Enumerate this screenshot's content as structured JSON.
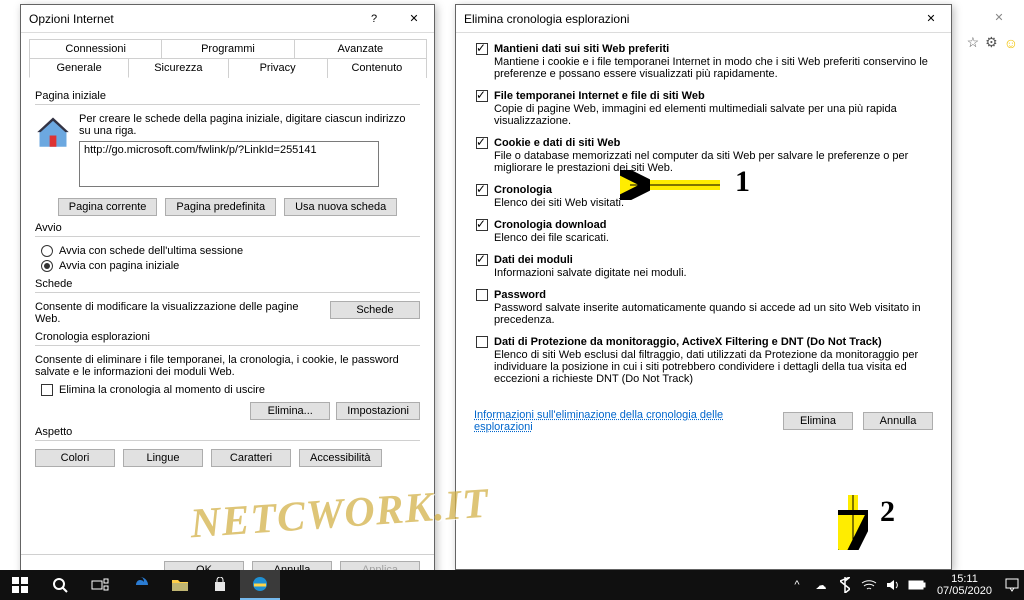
{
  "io": {
    "title": "Opzioni Internet",
    "tabs_row1": [
      "Connessioni",
      "Programmi",
      "Avanzate"
    ],
    "tabs_row2": [
      "Generale",
      "Sicurezza",
      "Privacy",
      "Contenuto"
    ],
    "active_tab": "Generale",
    "home": {
      "group": "Pagina iniziale",
      "hint": "Per creare le schede della pagina iniziale, digitare ciascun indirizzo su una riga.",
      "url": "http://go.microsoft.com/fwlink/p/?LinkId=255141",
      "btn_current": "Pagina corrente",
      "btn_default": "Pagina predefinita",
      "btn_newtab": "Usa nuova scheda"
    },
    "startup": {
      "group": "Avvio",
      "opt_last": "Avvia con schede dell'ultima sessione",
      "opt_home": "Avvia con pagina iniziale",
      "selected": "home"
    },
    "tabs_section": {
      "group": "Schede",
      "text": "Consente di modificare la visualizzazione delle pagine Web.",
      "btn": "Schede"
    },
    "history": {
      "group": "Cronologia esplorazioni",
      "text": "Consente di eliminare i file temporanei, la cronologia, i cookie, le password salvate e le informazioni dei moduli Web.",
      "chk": "Elimina la cronologia al momento di uscire",
      "btn_del": "Elimina...",
      "btn_set": "Impostazioni"
    },
    "appearance": {
      "group": "Aspetto",
      "btn_colors": "Colori",
      "btn_lang": "Lingue",
      "btn_fonts": "Caratteri",
      "btn_access": "Accessibilità"
    },
    "footer": {
      "ok": "OK",
      "cancel": "Annulla",
      "apply": "Applica"
    }
  },
  "del": {
    "title": "Elimina cronologia esplorazioni",
    "items": [
      {
        "checked": true,
        "hd": "Mantieni dati sui siti Web preferiti",
        "sub": "Mantiene i cookie e i file temporanei Internet in modo che i siti Web preferiti conservino le preferenze e possano essere visualizzati più rapidamente."
      },
      {
        "checked": true,
        "hd": "File temporanei Internet e file di siti Web",
        "sub": "Copie di pagine Web, immagini ed elementi multimediali salvate per una più rapida visualizzazione."
      },
      {
        "checked": true,
        "hd": "Cookie e dati di siti Web",
        "sub": "File o database memorizzati nel computer da siti Web per salvare le preferenze o per migliorare le prestazioni dei siti Web."
      },
      {
        "checked": true,
        "hd": "Cronologia",
        "sub": "Elenco dei siti Web visitati."
      },
      {
        "checked": true,
        "hd": "Cronologia download",
        "sub": "Elenco dei file scaricati."
      },
      {
        "checked": true,
        "hd": "Dati dei moduli",
        "sub": "Informazioni salvate digitate nei moduli."
      },
      {
        "checked": false,
        "hd": "Password",
        "sub": "Password salvate inserite automaticamente quando si accede ad un sito Web visitato in precedenza."
      },
      {
        "checked": false,
        "hd": "Dati di Protezione da monitoraggio, ActiveX Filtering e DNT (Do Not Track)",
        "sub": "Elenco di siti Web esclusi dal filtraggio, dati utilizzati da Protezione da monitoraggio per individuare la posizione in cui i siti potrebbero condividere i dettagli della tua visita ed eccezioni a richieste DNT (Do Not Track)"
      }
    ],
    "link": "Informazioni sull'eliminazione della cronologia delle esplorazioni",
    "btn_del": "Elimina",
    "btn_cancel": "Annulla"
  },
  "annotations": {
    "one": "1",
    "two": "2",
    "watermark": "NETCWORK.IT"
  },
  "taskbar": {
    "time": "15:11",
    "date": "07/05/2020"
  }
}
